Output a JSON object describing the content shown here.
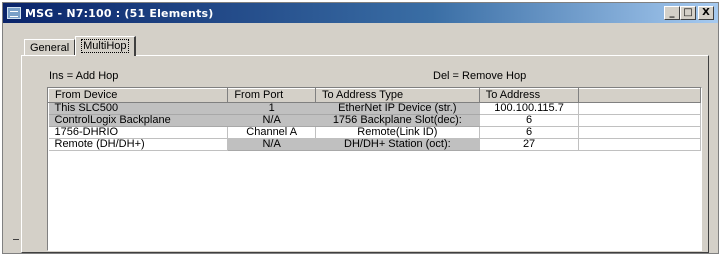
{
  "window": {
    "title": "MSG - N7:100 : (51 Elements)",
    "buttons": {
      "minimize": "_",
      "maximize": "□",
      "close": "X"
    }
  },
  "tabs": [
    {
      "label": "General",
      "active": false
    },
    {
      "label": "MultiHop",
      "active": true
    }
  ],
  "hints": {
    "insert": "Ins = Add Hop",
    "delete": "Del = Remove Hop"
  },
  "table": {
    "columns": [
      "From Device",
      "From Port",
      "To Address Type",
      "To Address"
    ],
    "rows": [
      {
        "from_device": "This SLC500",
        "from_port": "1",
        "to_address_type": "EtherNet IP Device (str.)",
        "to_address": "100.100.115.7"
      },
      {
        "from_device": "ControlLogix Backplane",
        "from_port": "N/A",
        "to_address_type": "1756 Backplane Slot(dec):",
        "to_address": "6"
      },
      {
        "from_device": "1756-DHRIO",
        "from_port": "Channel A",
        "to_address_type": "Remote(Link ID)",
        "to_address": "6"
      },
      {
        "from_device": "Remote (DH/DH+)",
        "from_port": "N/A",
        "to_address_type": "DH/DH+ Station (oct):",
        "to_address": "27"
      }
    ]
  },
  "colors": {
    "title_bar_start": "#0a246a",
    "title_bar_end": "#a6caf0",
    "dialog_face": "#d4d0c8",
    "readonly_cell": "#c0c0c0"
  }
}
